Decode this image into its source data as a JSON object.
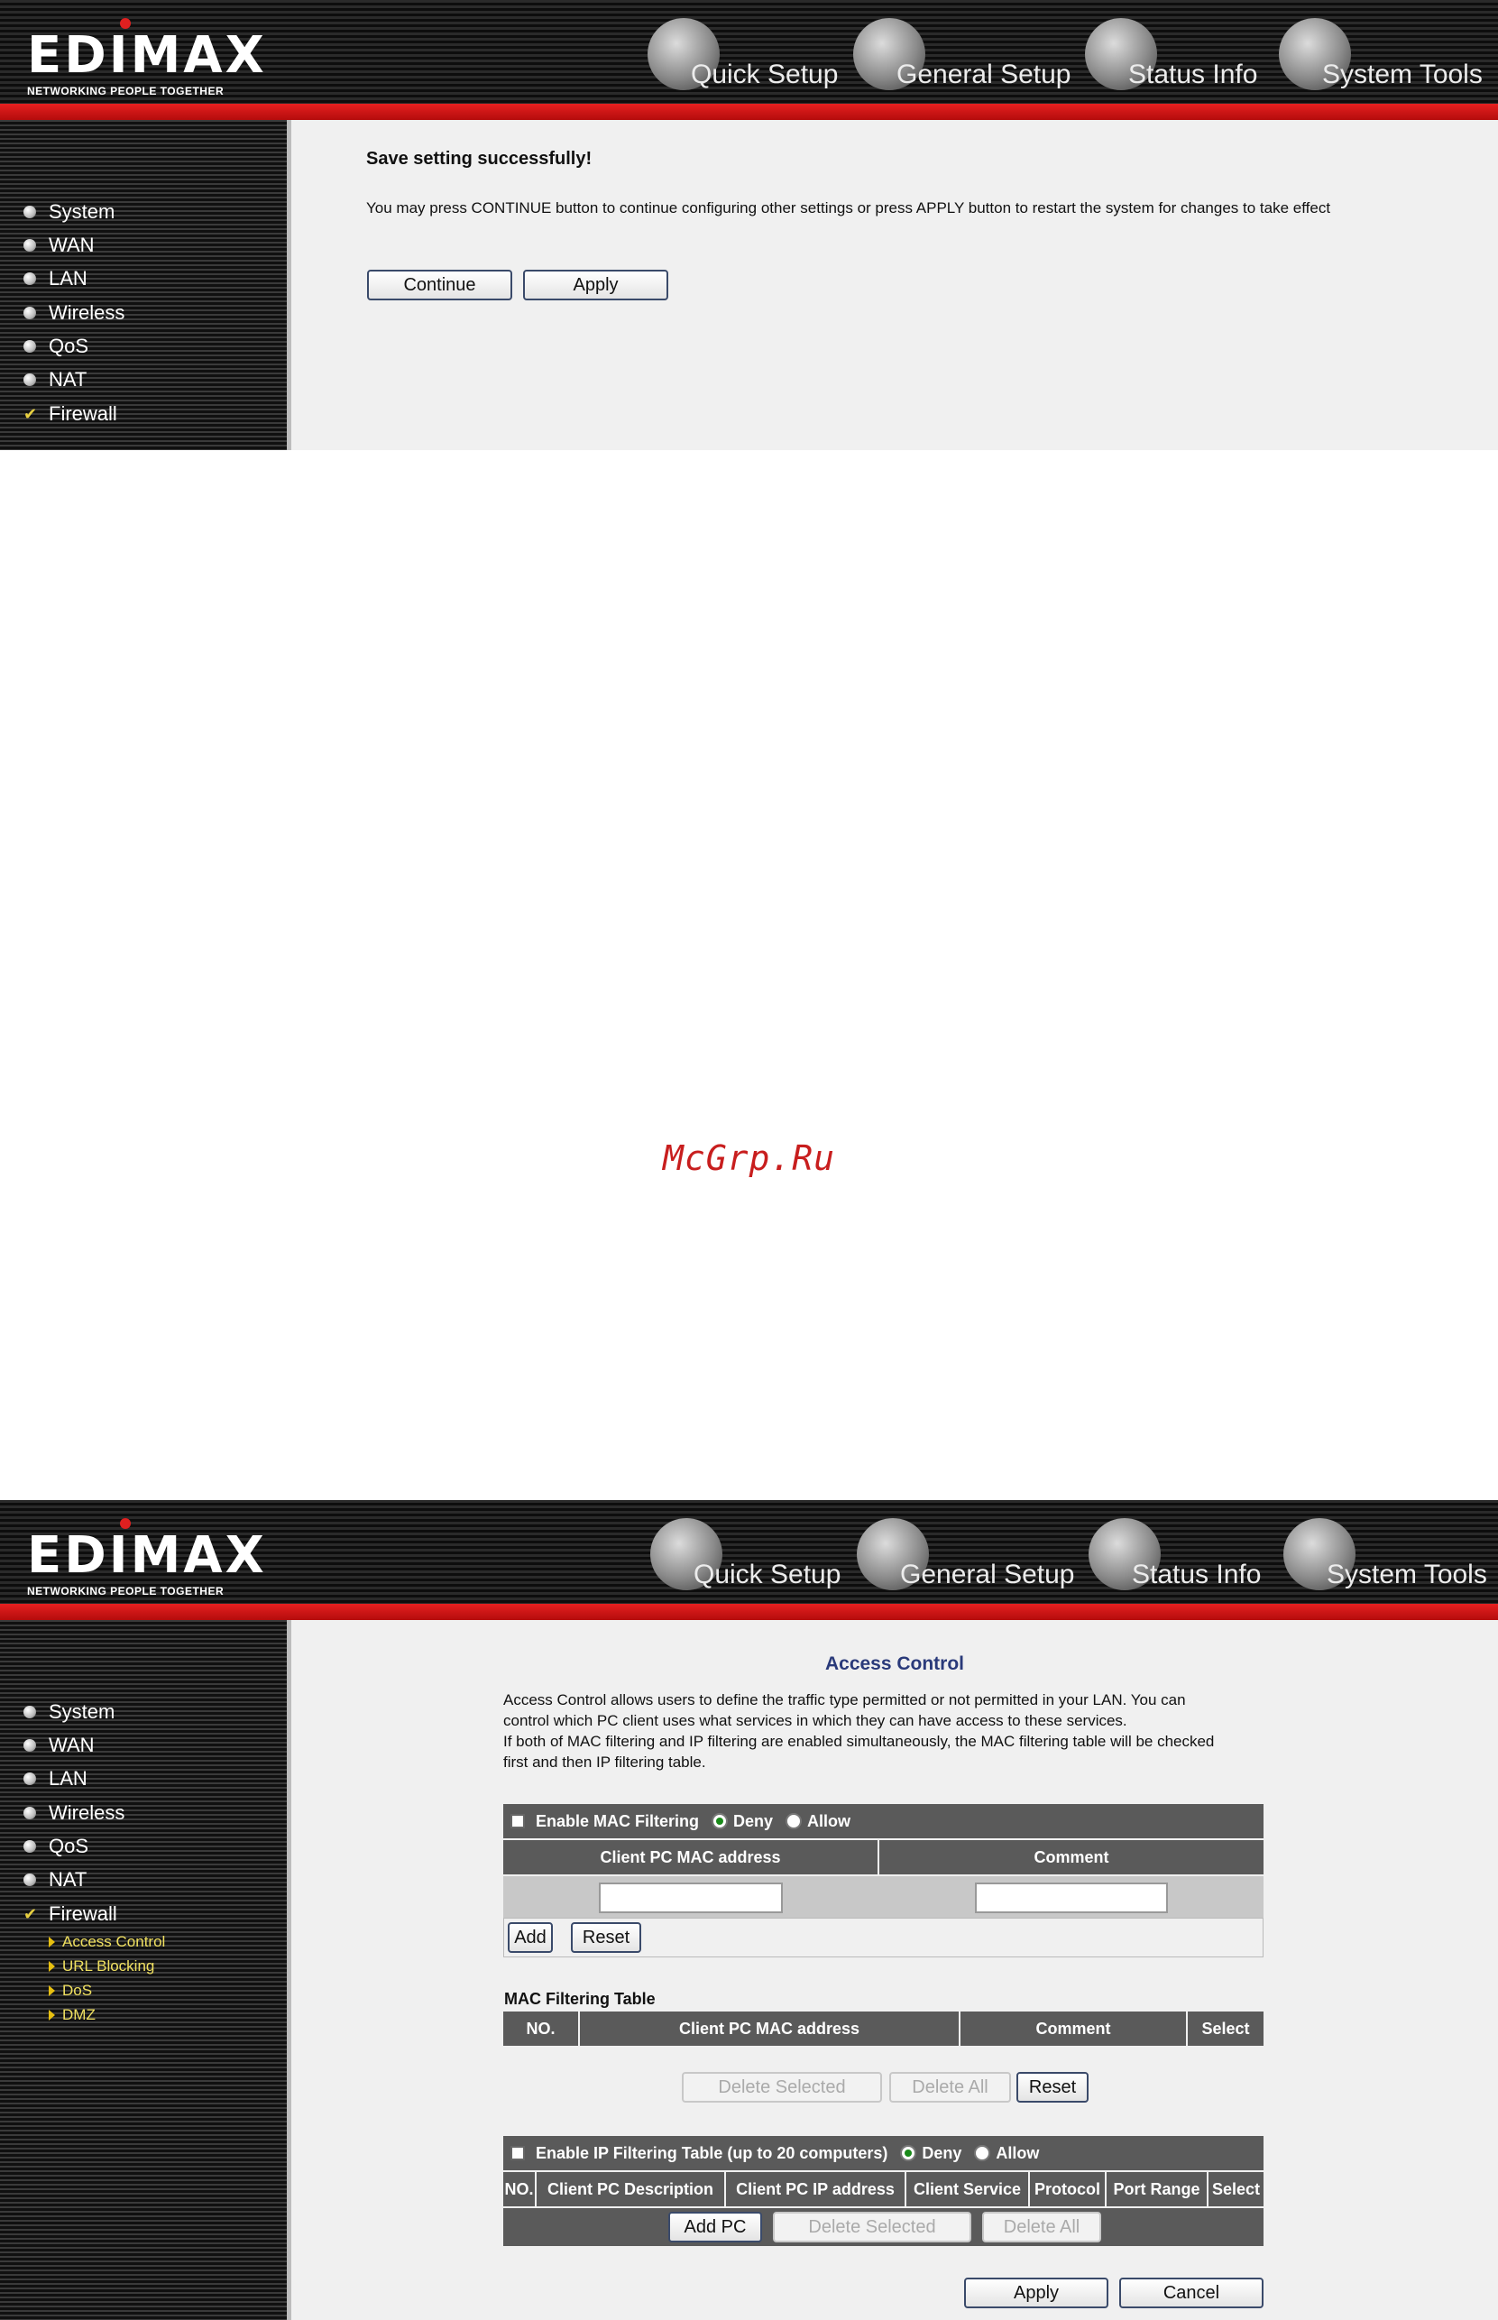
{
  "brand": {
    "name": "EDIMAX",
    "tagline": "NETWORKING PEOPLE TOGETHER"
  },
  "topnav": [
    "Quick Setup",
    "General Setup",
    "Status Info",
    "System Tools"
  ],
  "sidebar": {
    "items": [
      "System",
      "WAN",
      "LAN",
      "Wireless",
      "QoS",
      "NAT",
      "Firewall"
    ],
    "firewall_subitems": [
      "Access Control",
      "URL Blocking",
      "DoS",
      "DMZ"
    ]
  },
  "save_page": {
    "title": "Save setting successfully!",
    "message": "You may press CONTINUE button to continue configuring other settings or press APPLY button to restart the system for changes to take effect",
    "continue_label": "Continue",
    "apply_label": "Apply"
  },
  "watermark": "McGrp.Ru",
  "access_control": {
    "title": "Access Control",
    "desc_lines": [
      "Access Control allows users to define the traffic type permitted or not permitted in your LAN. You can",
      "control which PC client uses what services in which they can have access to these services.",
      "If both of MAC filtering and IP filtering are enabled simultaneously, the MAC filtering table will be checked",
      "first and then IP filtering table."
    ],
    "mac_filter": {
      "enable_label": "Enable MAC Filtering",
      "deny_label": "Deny",
      "allow_label": "Allow",
      "col_mac": "Client PC MAC address",
      "col_comment": "Comment",
      "add_label": "Add",
      "reset_label": "Reset"
    },
    "mac_table": {
      "title": "MAC Filtering Table",
      "columns": [
        "NO.",
        "Client PC MAC address",
        "Comment",
        "Select"
      ],
      "delete_selected": "Delete Selected",
      "delete_all": "Delete All",
      "reset_label": "Reset"
    },
    "ip_filter": {
      "enable_label": "Enable IP Filtering Table (up to 20 computers)",
      "deny_label": "Deny",
      "allow_label": "Allow",
      "columns": [
        "NO.",
        "Client PC Description",
        "Client PC IP address",
        "Client Service",
        "Protocol",
        "Port Range",
        "Select"
      ],
      "add_pc": "Add PC",
      "delete_selected": "Delete Selected",
      "delete_all": "Delete All"
    },
    "apply_label": "Apply",
    "cancel_label": "Cancel"
  }
}
